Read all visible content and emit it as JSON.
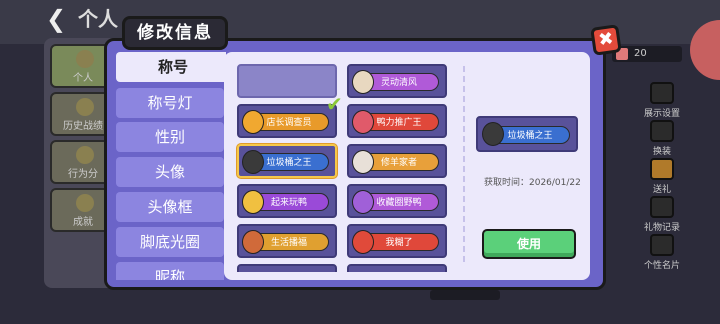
{
  "background": {
    "back_glyph": "❮",
    "header_title": "个人",
    "side_items": [
      {
        "label": "个人",
        "active": true
      },
      {
        "label": "历史战绩",
        "active": false
      },
      {
        "label": "行为分",
        "active": false
      },
      {
        "label": "成就",
        "active": false
      }
    ],
    "like_count": "20",
    "right_items": [
      {
        "label": "展示设置",
        "icon": "display-settings-icon"
      },
      {
        "label": "换装",
        "icon": "hanger-icon"
      },
      {
        "label": "送礼",
        "icon": "gift-icon"
      },
      {
        "label": "礼物记录",
        "icon": "gift-record-icon"
      },
      {
        "label": "个性名片",
        "icon": "profile-card-icon"
      }
    ]
  },
  "modal": {
    "title": "修改信息",
    "close_glyph": "✖",
    "menu": [
      {
        "label": "称号",
        "active": true
      },
      {
        "label": "称号灯",
        "active": false
      },
      {
        "label": "性别",
        "active": false
      },
      {
        "label": "头像",
        "active": false
      },
      {
        "label": "头像框",
        "active": false
      },
      {
        "label": "脚底光圈",
        "active": false
      },
      {
        "label": "昵称",
        "active": false
      }
    ],
    "check_glyph": "✔",
    "titles": [
      {
        "label": "",
        "color": "",
        "empty": true,
        "selected": false
      },
      {
        "label": "灵动清风",
        "color": "#b05ad8",
        "empty": false,
        "selected": false
      },
      {
        "label": "店长调查员",
        "color": "#e89a2a",
        "empty": false,
        "selected": false
      },
      {
        "label": "鸭力推广王",
        "color": "#e0483a",
        "empty": false,
        "selected": false
      },
      {
        "label": "垃圾桶之王",
        "color": "#3a6fd0",
        "empty": false,
        "selected": true
      },
      {
        "label": "修羊家者",
        "color": "#e8a03a",
        "empty": false,
        "selected": false
      },
      {
        "label": "起来玩鸭",
        "color": "#9a4ad8",
        "empty": false,
        "selected": false
      },
      {
        "label": "收藏圈野鸭",
        "color": "#b05ad8",
        "empty": false,
        "selected": false
      },
      {
        "label": "生活播福",
        "color": "#e0a030",
        "empty": false,
        "selected": false
      },
      {
        "label": "我糊了",
        "color": "#e0483a",
        "empty": false,
        "selected": false
      }
    ],
    "detail": {
      "title_label": "垃圾桶之王",
      "title_color": "#3a6fd0",
      "obtain_time": "获取时间：2026/01/22",
      "use_button": "使用"
    }
  }
}
